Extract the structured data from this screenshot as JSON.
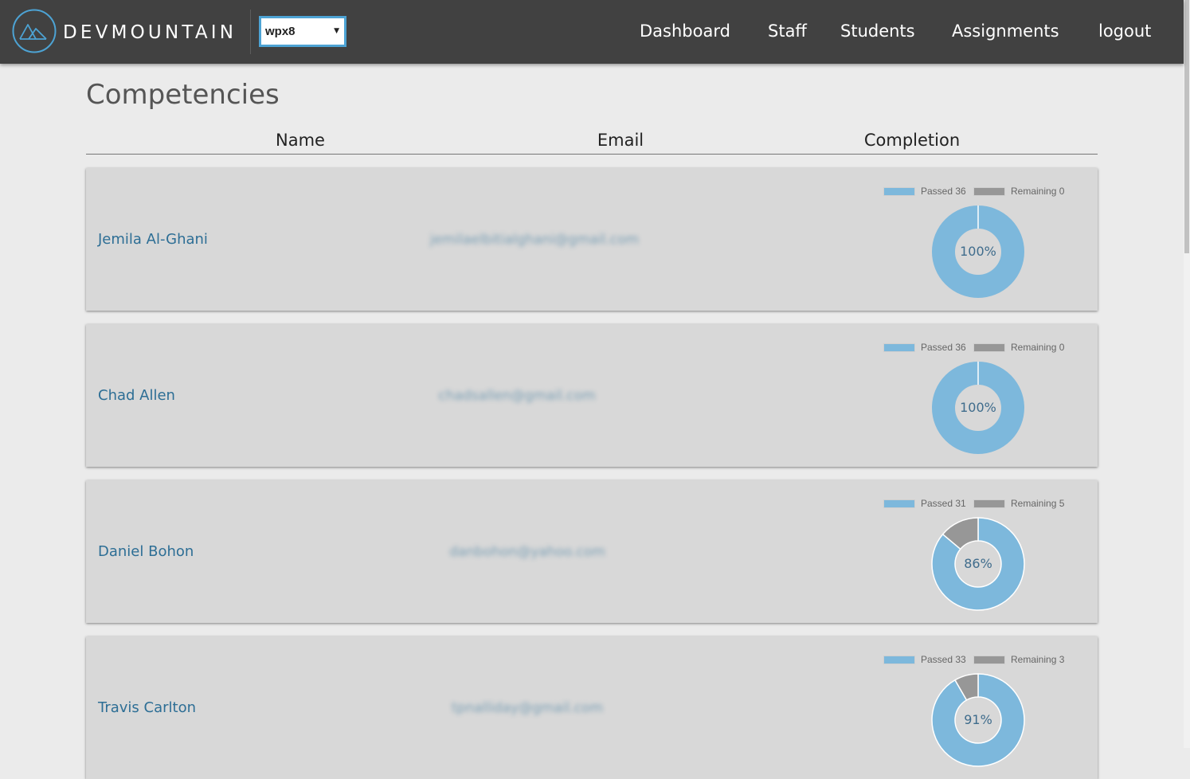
{
  "header": {
    "brand": "DEVMOUNTAIN",
    "cohort_select_value": "wpx8",
    "nav": [
      {
        "id": "dashboard",
        "label": "Dashboard"
      },
      {
        "id": "staff",
        "label": "Staff"
      },
      {
        "id": "students",
        "label": "Students"
      },
      {
        "id": "assignments",
        "label": "Assignments"
      },
      {
        "id": "logout",
        "label": "logout"
      }
    ]
  },
  "page": {
    "title": "Competencies",
    "columns": {
      "name": "Name",
      "email": "Email",
      "completion": "Completion"
    }
  },
  "legend_labels": {
    "passed": "Passed",
    "remaining": "Remaining"
  },
  "colors": {
    "passed": "#7db8dc",
    "remaining": "#979797",
    "brand_accent": "#4da3d4",
    "name_link": "#2d6e95"
  },
  "students": [
    {
      "name": "Jemila Al-Ghani",
      "email": "jemilaelbitialghani@gmail.com",
      "passed": 36,
      "remaining": 0,
      "percent": "100%"
    },
    {
      "name": "Chad Allen",
      "email": "chadsallen@gmail.com",
      "passed": 36,
      "remaining": 0,
      "percent": "100%"
    },
    {
      "name": "Daniel Bohon",
      "email": "danbohon@yahoo.com",
      "passed": 31,
      "remaining": 5,
      "percent": "86%"
    },
    {
      "name": "Travis Carlton",
      "email": "tpnalliday@gmail.com",
      "passed": 33,
      "remaining": 3,
      "percent": "91%"
    }
  ]
}
